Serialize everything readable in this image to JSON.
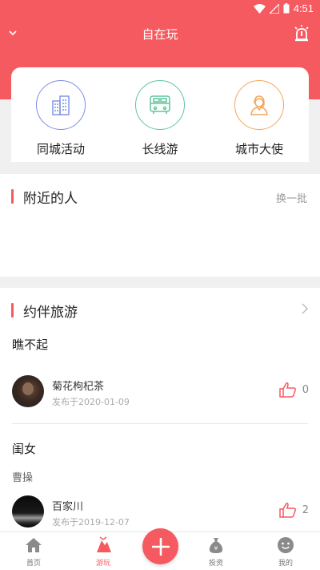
{
  "status_bar": {
    "time": "4:51"
  },
  "header": {
    "title": "自在玩"
  },
  "categories": [
    {
      "label": "同城活动",
      "icon": "building-icon",
      "color": "#7b8de6"
    },
    {
      "label": "长线游",
      "icon": "bus-icon",
      "color": "#5cc79a"
    },
    {
      "label": "城市大使",
      "icon": "ambassador-icon",
      "color": "#f2a65a"
    }
  ],
  "nearby": {
    "title": "附近的人",
    "refresh_label": "换一批"
  },
  "companion": {
    "title": "约伴旅游",
    "posts": [
      {
        "title": "瞧不起",
        "subtitle": "",
        "user": "菊花枸杞茶",
        "date": "发布于2020-01-09",
        "likes": "0"
      },
      {
        "title": "闺女",
        "subtitle": "曹操",
        "user": "百家川",
        "date": "发布于2019-12-07",
        "likes": "2"
      }
    ]
  },
  "tabbar": {
    "items": [
      {
        "label": "首页",
        "icon": "home-icon"
      },
      {
        "label": "游玩",
        "icon": "play-icon"
      },
      {
        "label": "",
        "icon": "plus-icon"
      },
      {
        "label": "投资",
        "icon": "money-bag-icon"
      },
      {
        "label": "我的",
        "icon": "smile-icon"
      }
    ]
  },
  "colors": {
    "accent": "#f55a60"
  }
}
